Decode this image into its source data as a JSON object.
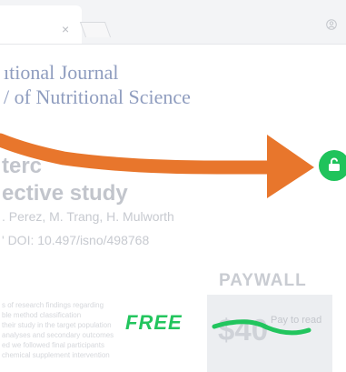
{
  "browser": {
    "tab_close": "×",
    "icons": {
      "user": "user-circle-icon",
      "new_tab": "new-tab-icon"
    }
  },
  "journal": {
    "name_line1": "ıtional Journal",
    "name_line2": "/ of Nutritional Science"
  },
  "article": {
    "title_line1": "terc",
    "title_line2": "ective study",
    "authors": ". Perez, M. Trang, H. Mulworth",
    "doi": "'  DOI: 10.497/isno/498768"
  },
  "body_text": [
    "s of research findings regarding",
    "ble method classification",
    "their study in the target population",
    "analyses and secondary outcomes",
    "ed we followed final participants",
    "chemical supplement intervention"
  ],
  "paywall": {
    "label": "PAYWALL",
    "price": "$40",
    "pay_to_read": "Pay to read",
    "free_label": "FREE"
  },
  "colors": {
    "accent_orange": "#e8762c",
    "accent_green": "#1fc35b",
    "free_green": "#23c55e"
  },
  "icons": {
    "arrow": "right-arrow-icon",
    "unlock": "unlocked-padlock-icon",
    "strike": "strikethrough-line"
  }
}
